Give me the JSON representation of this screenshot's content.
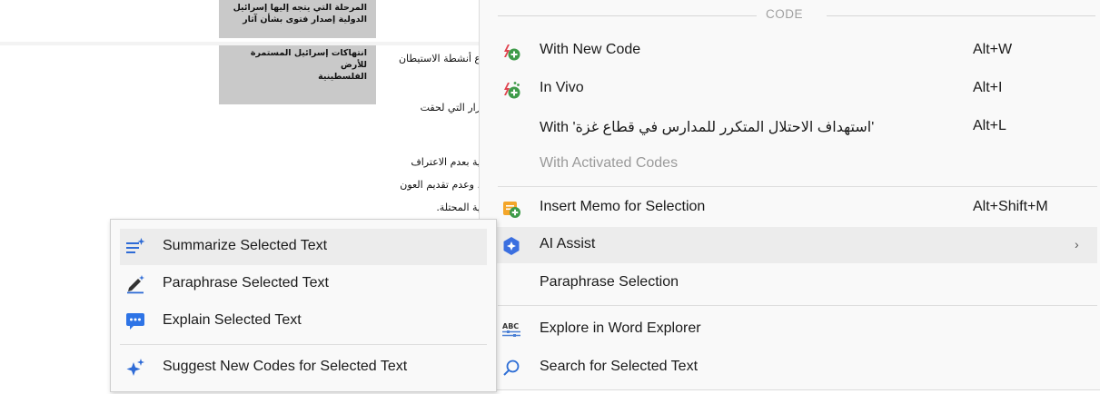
{
  "document": {
    "box1_lines": [
      "المرحلة التي يتجه إليها إسرائيل",
      "الدولية إصدار فتوى بشأن آثار"
    ],
    "box2_lines": [
      "انتهاكات إسرائيل المستمرة للأرض",
      "الفلسطينية"
    ],
    "text_lines": [
      "ع أنشطة الاستيطان",
      "رار التي لحقت",
      "ية بعدم الاعتراف",
      "، وعدم تقديم العون",
      "ية المحتلة."
    ]
  },
  "menu": {
    "section_header": "CODE",
    "items": [
      {
        "label": "With New Code",
        "shortcut": "Alt+W",
        "icon": "new-code-icon"
      },
      {
        "label": "In Vivo",
        "shortcut": "Alt+I",
        "icon": "in-vivo-icon"
      },
      {
        "label": "With 'استهداف الاحتلال المتكرر للمدارس في قطاع غزة'",
        "shortcut": "Alt+L",
        "icon": ""
      },
      {
        "label": "With Activated Codes",
        "shortcut": "",
        "icon": "",
        "disabled": true
      },
      {
        "label": "Insert Memo for Selection",
        "shortcut": "Alt+Shift+M",
        "icon": "memo-icon"
      },
      {
        "label": "AI Assist",
        "shortcut": "",
        "icon": "ai-assist-icon",
        "submenu": true
      },
      {
        "label": "Paraphrase Selection",
        "shortcut": "",
        "icon": ""
      },
      {
        "label": "Explore in Word Explorer",
        "shortcut": "",
        "icon": "word-explorer-icon",
        "icon_text": "ABC"
      },
      {
        "label": "Search for Selected Text",
        "shortcut": "",
        "icon": "search-icon"
      }
    ]
  },
  "submenu": {
    "items": [
      {
        "label": "Summarize Selected Text",
        "icon": "summarize-icon"
      },
      {
        "label": "Paraphrase Selected Text",
        "icon": "paraphrase-icon"
      },
      {
        "label": "Explain Selected Text",
        "icon": "explain-icon"
      },
      {
        "label": "Suggest New Codes for Selected Text",
        "icon": "sparkle-icon"
      }
    ]
  },
  "colors": {
    "code_icon_red": "#e0434f",
    "code_icon_green": "#3f9b4a",
    "memo_orange": "#f4a62a",
    "ai_blue": "#3b6fe0",
    "explain_blue": "#2e74e6",
    "menu_bg": "#f9f9f9",
    "hover_bg": "#ececec"
  }
}
